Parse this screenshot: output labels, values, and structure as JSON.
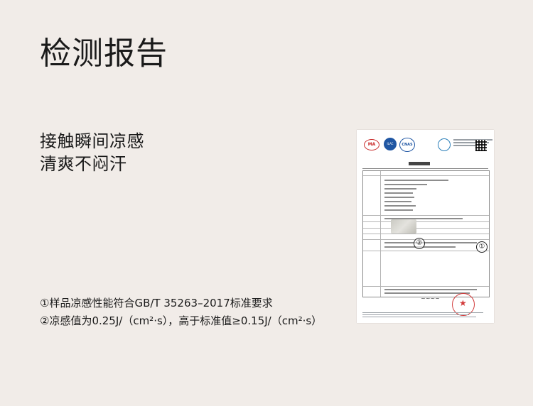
{
  "page": {
    "title": "检测报告",
    "feature_lines": [
      "接触瞬间凉感",
      "清爽不闷汗"
    ],
    "notes": [
      "①样品凉感性能符合GB/T 35263–2017标准要求",
      "②凉感值为0.25J/（cm²·s），高于标准值≥0.15J/（cm²·s）"
    ]
  },
  "report": {
    "marker_1": "①",
    "marker_2": "②",
    "logo_cma": "MA",
    "logo_cnas": "CNAS",
    "accent_red": "#c92a2a",
    "accent_blue": "#1f56a3"
  }
}
